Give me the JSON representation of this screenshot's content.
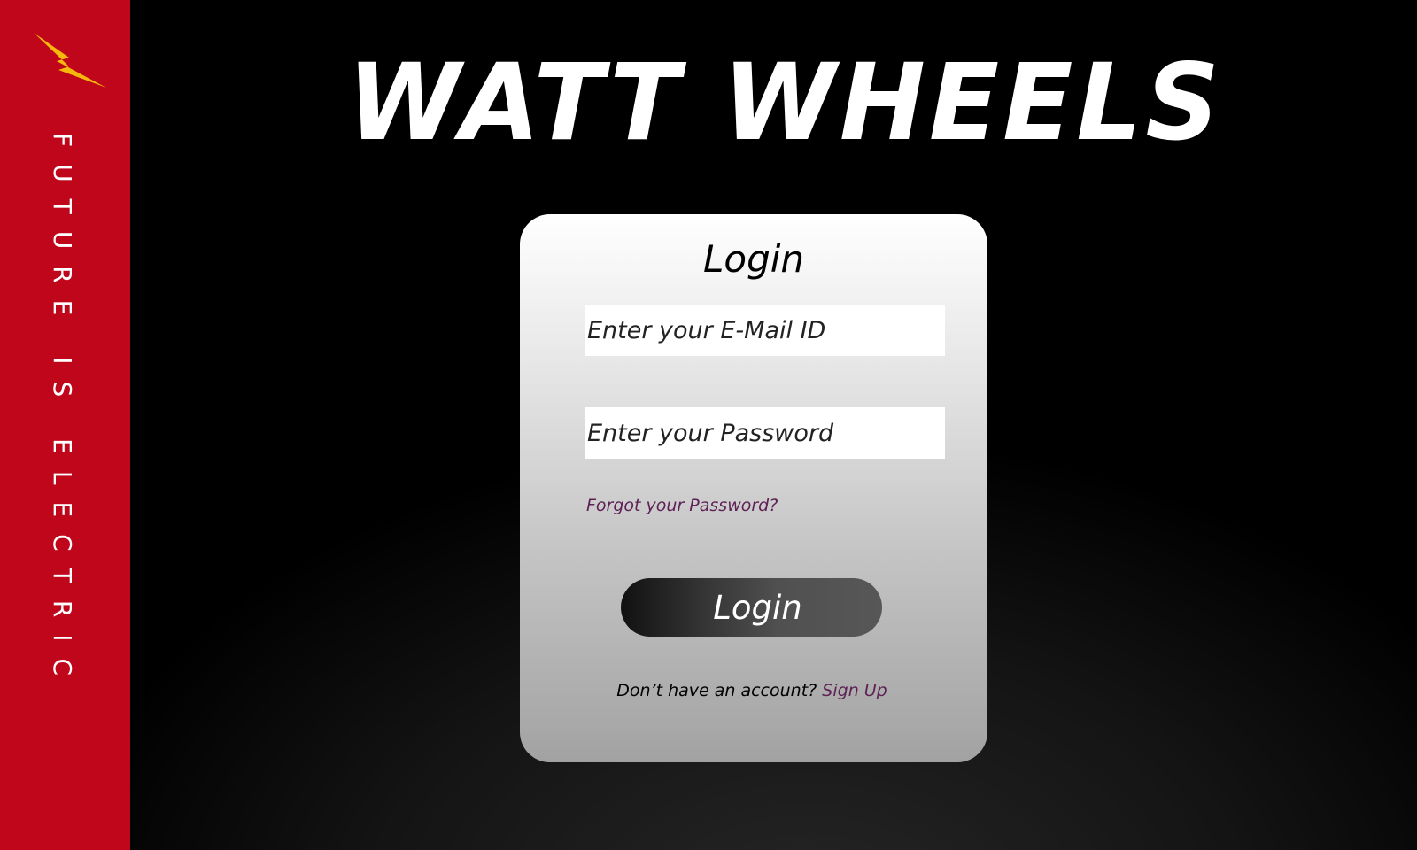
{
  "sidebar": {
    "logo_icon": "lightning-bolt-icon",
    "tagline": "FUTURE IS ELECTRIC",
    "background_color": "#c0061a",
    "logo_color": "#f5b80c"
  },
  "header": {
    "title": "WATT WHEELS"
  },
  "login_form": {
    "title": "Login",
    "email_placeholder": "Enter your E-Mail ID",
    "password_placeholder": "Enter your Password",
    "forgot_password_label": "Forgot your Password?",
    "submit_label": "Login",
    "signup_prompt": "Don’t have an account?",
    "signup_link_label": "Sign Up",
    "link_color": "#5e2156"
  }
}
